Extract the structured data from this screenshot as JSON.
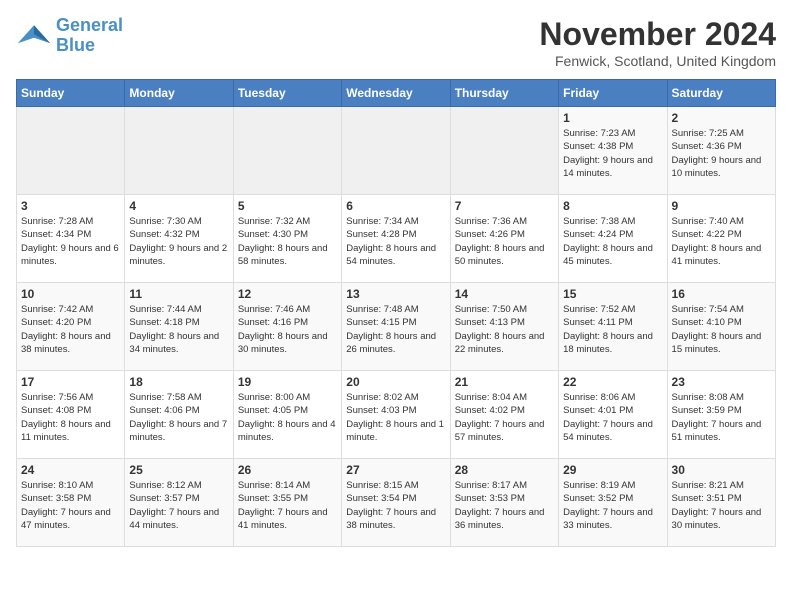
{
  "logo": {
    "line1": "General",
    "line2": "Blue"
  },
  "title": "November 2024",
  "subtitle": "Fenwick, Scotland, United Kingdom",
  "days_of_week": [
    "Sunday",
    "Monday",
    "Tuesday",
    "Wednesday",
    "Thursday",
    "Friday",
    "Saturday"
  ],
  "weeks": [
    [
      {
        "day": "",
        "info": ""
      },
      {
        "day": "",
        "info": ""
      },
      {
        "day": "",
        "info": ""
      },
      {
        "day": "",
        "info": ""
      },
      {
        "day": "",
        "info": ""
      },
      {
        "day": "1",
        "info": "Sunrise: 7:23 AM\nSunset: 4:38 PM\nDaylight: 9 hours and 14 minutes."
      },
      {
        "day": "2",
        "info": "Sunrise: 7:25 AM\nSunset: 4:36 PM\nDaylight: 9 hours and 10 minutes."
      }
    ],
    [
      {
        "day": "3",
        "info": "Sunrise: 7:28 AM\nSunset: 4:34 PM\nDaylight: 9 hours and 6 minutes."
      },
      {
        "day": "4",
        "info": "Sunrise: 7:30 AM\nSunset: 4:32 PM\nDaylight: 9 hours and 2 minutes."
      },
      {
        "day": "5",
        "info": "Sunrise: 7:32 AM\nSunset: 4:30 PM\nDaylight: 8 hours and 58 minutes."
      },
      {
        "day": "6",
        "info": "Sunrise: 7:34 AM\nSunset: 4:28 PM\nDaylight: 8 hours and 54 minutes."
      },
      {
        "day": "7",
        "info": "Sunrise: 7:36 AM\nSunset: 4:26 PM\nDaylight: 8 hours and 50 minutes."
      },
      {
        "day": "8",
        "info": "Sunrise: 7:38 AM\nSunset: 4:24 PM\nDaylight: 8 hours and 45 minutes."
      },
      {
        "day": "9",
        "info": "Sunrise: 7:40 AM\nSunset: 4:22 PM\nDaylight: 8 hours and 41 minutes."
      }
    ],
    [
      {
        "day": "10",
        "info": "Sunrise: 7:42 AM\nSunset: 4:20 PM\nDaylight: 8 hours and 38 minutes."
      },
      {
        "day": "11",
        "info": "Sunrise: 7:44 AM\nSunset: 4:18 PM\nDaylight: 8 hours and 34 minutes."
      },
      {
        "day": "12",
        "info": "Sunrise: 7:46 AM\nSunset: 4:16 PM\nDaylight: 8 hours and 30 minutes."
      },
      {
        "day": "13",
        "info": "Sunrise: 7:48 AM\nSunset: 4:15 PM\nDaylight: 8 hours and 26 minutes."
      },
      {
        "day": "14",
        "info": "Sunrise: 7:50 AM\nSunset: 4:13 PM\nDaylight: 8 hours and 22 minutes."
      },
      {
        "day": "15",
        "info": "Sunrise: 7:52 AM\nSunset: 4:11 PM\nDaylight: 8 hours and 18 minutes."
      },
      {
        "day": "16",
        "info": "Sunrise: 7:54 AM\nSunset: 4:10 PM\nDaylight: 8 hours and 15 minutes."
      }
    ],
    [
      {
        "day": "17",
        "info": "Sunrise: 7:56 AM\nSunset: 4:08 PM\nDaylight: 8 hours and 11 minutes."
      },
      {
        "day": "18",
        "info": "Sunrise: 7:58 AM\nSunset: 4:06 PM\nDaylight: 8 hours and 7 minutes."
      },
      {
        "day": "19",
        "info": "Sunrise: 8:00 AM\nSunset: 4:05 PM\nDaylight: 8 hours and 4 minutes."
      },
      {
        "day": "20",
        "info": "Sunrise: 8:02 AM\nSunset: 4:03 PM\nDaylight: 8 hours and 1 minute."
      },
      {
        "day": "21",
        "info": "Sunrise: 8:04 AM\nSunset: 4:02 PM\nDaylight: 7 hours and 57 minutes."
      },
      {
        "day": "22",
        "info": "Sunrise: 8:06 AM\nSunset: 4:01 PM\nDaylight: 7 hours and 54 minutes."
      },
      {
        "day": "23",
        "info": "Sunrise: 8:08 AM\nSunset: 3:59 PM\nDaylight: 7 hours and 51 minutes."
      }
    ],
    [
      {
        "day": "24",
        "info": "Sunrise: 8:10 AM\nSunset: 3:58 PM\nDaylight: 7 hours and 47 minutes."
      },
      {
        "day": "25",
        "info": "Sunrise: 8:12 AM\nSunset: 3:57 PM\nDaylight: 7 hours and 44 minutes."
      },
      {
        "day": "26",
        "info": "Sunrise: 8:14 AM\nSunset: 3:55 PM\nDaylight: 7 hours and 41 minutes."
      },
      {
        "day": "27",
        "info": "Sunrise: 8:15 AM\nSunset: 3:54 PM\nDaylight: 7 hours and 38 minutes."
      },
      {
        "day": "28",
        "info": "Sunrise: 8:17 AM\nSunset: 3:53 PM\nDaylight: 7 hours and 36 minutes."
      },
      {
        "day": "29",
        "info": "Sunrise: 8:19 AM\nSunset: 3:52 PM\nDaylight: 7 hours and 33 minutes."
      },
      {
        "day": "30",
        "info": "Sunrise: 8:21 AM\nSunset: 3:51 PM\nDaylight: 7 hours and 30 minutes."
      }
    ]
  ]
}
